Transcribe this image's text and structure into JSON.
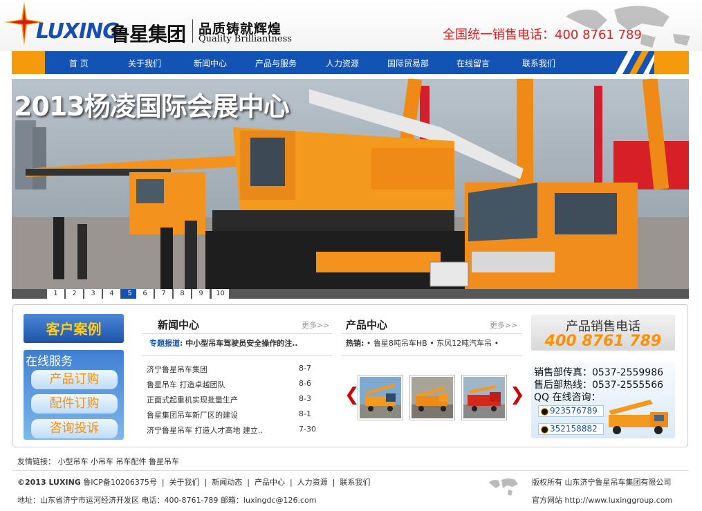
{
  "header": {
    "logo_en": "LUXING",
    "logo_cn": "鲁星集团",
    "slogan_cn": "品质铸就辉煌",
    "slogan_en": "Quality Brilliantness",
    "hotline": "全国统一销售电话：400 8761 789"
  },
  "nav": {
    "items": [
      "首 页",
      "关于我们",
      "新闻中心",
      "产品与服务",
      "人力资源",
      "国际贸易部",
      "在线留言",
      "联系我们"
    ]
  },
  "banner": {
    "title": "2013杨凌国际会展中心",
    "pages": [
      "1",
      "2",
      "3",
      "4",
      "5",
      "6",
      "7",
      "8",
      "9",
      "10"
    ],
    "active_page": "5"
  },
  "left_panel": {
    "case_label": "客户案例",
    "service_title": "在线服务",
    "buttons": [
      "产品订购",
      "配件订购",
      "咨询投诉"
    ]
  },
  "news": {
    "title": "新闻中心",
    "more": "更多>>",
    "topic_label": "专题报道:",
    "topic_text": "中小型吊车驾驶员安全操作的注..",
    "rows": [
      {
        "title": "济宁鲁星吊车集团",
        "date": "8-7"
      },
      {
        "title": "鲁星吊车 打造卓越团队",
        "date": "8-6"
      },
      {
        "title": "正面式起重机实现批量生产",
        "date": "8-3"
      },
      {
        "title": "鲁星集团吊车新厂区的建设",
        "date": "8-1"
      },
      {
        "title": "济宁鲁星吊车 打造人才高地 建立..",
        "date": "7-30"
      }
    ]
  },
  "products": {
    "title": "产品中心",
    "more": "更多>>",
    "hot_label": "热销:",
    "hot_text": "• 鲁星8吨吊车HB  • 东风12吨汽车吊  •",
    "prev": "❮",
    "next": "❯"
  },
  "sales": {
    "title": "产品销售电话",
    "number": "400 8761 789",
    "fax": "销售部传真：0537-2559986",
    "after": "售后部热线：0537-2555566",
    "qq_label": "QQ 在线咨询：",
    "qq": [
      "923576789",
      "352158882"
    ]
  },
  "footer": {
    "friend_label": "友情链接：",
    "friend_links": [
      "小型吊车",
      "小吊车",
      "吊车配件",
      "鲁星吊车"
    ],
    "copyright": "©2013 LUXING",
    "icp": "鲁ICP备10206375号",
    "links": [
      "关于我们",
      "新闻动态",
      "产品中心",
      "人力资源",
      "联系我们"
    ],
    "address": "地址：山东省济宁市运河经济开发区  电话：400-8761-789   邮箱：luxingdc@126.com",
    "rights": "版权所有 山东济宁鲁星吊车集团有限公司",
    "site": "官方网站 http://www.luxinggroup.com"
  },
  "colors": {
    "nav_blue": "#1353b3",
    "accent_orange": "#f59a0c",
    "hotline_red": "#e41d1d"
  }
}
